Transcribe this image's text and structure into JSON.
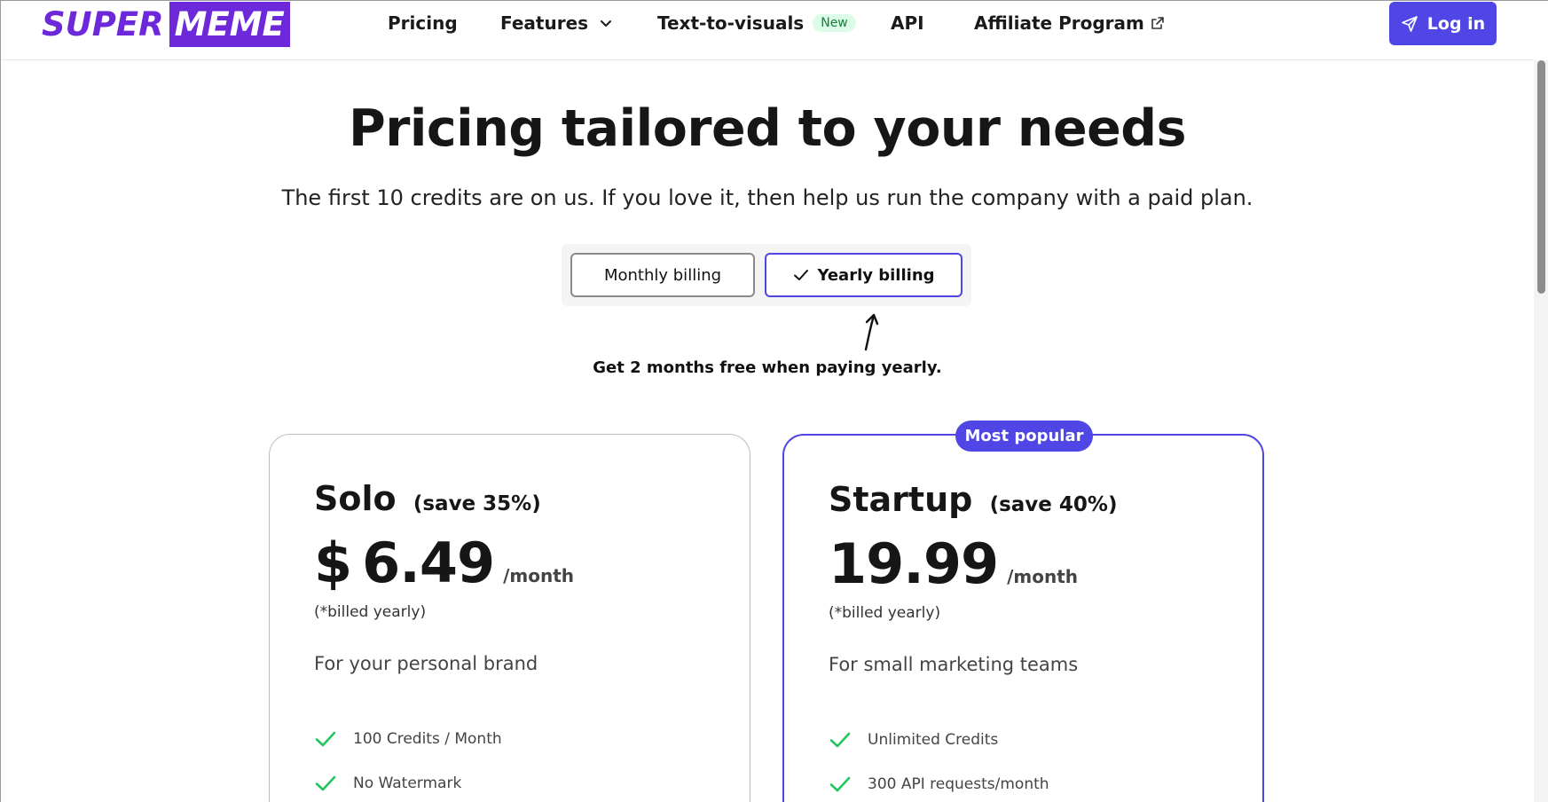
{
  "header": {
    "logo_left": "SUPER",
    "logo_right": "MEME",
    "nav": {
      "pricing": "Pricing",
      "features": "Features",
      "text_to_visuals": "Text-to-visuals",
      "text_to_visuals_badge": "New",
      "api": "API",
      "affiliate": "Affiliate Program"
    },
    "login_label": "Log in"
  },
  "hero": {
    "title": "Pricing tailored to your needs",
    "subtitle": "The first 10 credits are on us. If you love it, then help us run the company with a paid plan."
  },
  "billing_toggle": {
    "monthly_label": "Monthly billing",
    "yearly_label": "Yearly billing",
    "selected": "yearly",
    "promo": "Get 2 months free when paying yearly."
  },
  "plans": [
    {
      "name": "Solo",
      "save": "(save 35%)",
      "currency": "$",
      "price": "6.49",
      "per": "/month",
      "billed": "(*billed yearly)",
      "description": "For your personal brand",
      "features": [
        "100 Credits / Month",
        "No Watermark"
      ]
    },
    {
      "name": "Startup",
      "save": "(save 40%)",
      "currency": "",
      "price": "19.99",
      "per": "/month",
      "billed": "(*billed yearly)",
      "description": "For small marketing teams",
      "features": [
        "Unlimited Credits",
        "300 API requests/month"
      ],
      "badge": "Most popular"
    }
  ],
  "colors": {
    "brand": "#6d28d9",
    "accent": "#4f46e5",
    "check": "#22c55e",
    "new_badge_bg": "#dcfce7"
  }
}
